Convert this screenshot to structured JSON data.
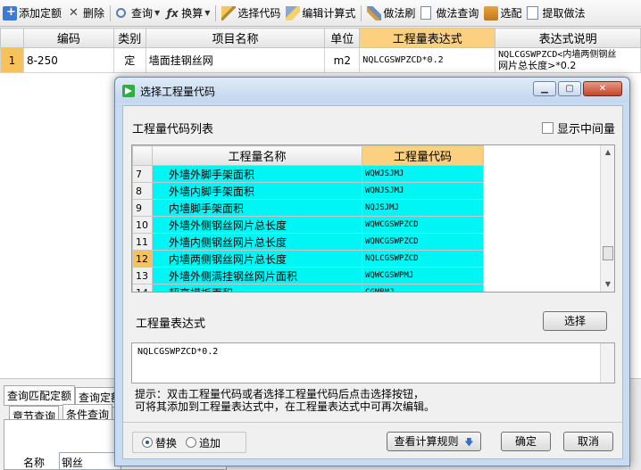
{
  "toolbar": {
    "add_quota": "添加定额",
    "delete": "删除",
    "query": "查询",
    "convert": "换算",
    "pick_code": "选择代码",
    "edit_formula": "编辑计算式",
    "method_brush": "做法刷",
    "method_query": "做法查询",
    "match": "选配",
    "extract_method": "提取做法"
  },
  "main_grid": {
    "columns": [
      "编码",
      "类别",
      "项目名称",
      "单位",
      "工程量表达式",
      "表达式说明"
    ],
    "rows": [
      {
        "num": "1",
        "code": "8-250",
        "type": "定",
        "name": "墙面挂钢丝网",
        "unit": "m2",
        "expr": "NQLCGSWPZCD*0.2",
        "desc_line1": "NQLCGSWPZCD<内墙两侧钢丝",
        "desc_line2": "网片总长度>*0.2"
      }
    ]
  },
  "lower_panel": {
    "tab_match": "查询匹配定额",
    "tab_query": "查询定额",
    "tab_chapter": "章节查询",
    "tab_condition": "条件查询",
    "name_label": "名称",
    "name_value": "钢丝"
  },
  "dialog": {
    "title": "选择工程量代码",
    "list_label": "工程量代码列表",
    "show_intermediate": "显示中间量",
    "col_name": "工程量名称",
    "col_code": "工程量代码",
    "items": [
      {
        "num": "7",
        "name": "外墙外脚手架面积",
        "code": "WQWJSJMJ"
      },
      {
        "num": "8",
        "name": "外墙内脚手架面积",
        "code": "WQNJSJMJ"
      },
      {
        "num": "9",
        "name": "内墙脚手架面积",
        "code": "NQJSJMJ"
      },
      {
        "num": "10",
        "name": "外墙外侧钢丝网片总长度",
        "code": "WQWCGSWPZCD"
      },
      {
        "num": "11",
        "name": "外墙内侧钢丝网片总长度",
        "code": "WQNCGSWPZCD"
      },
      {
        "num": "12",
        "name": "内墙两侧钢丝网片总长度",
        "code": "NQLCGSWPZCD"
      },
      {
        "num": "13",
        "name": "外墙外侧满挂钢丝网片面积",
        "code": "WQWCGSWPMJ"
      },
      {
        "num": "14",
        "name": "超高模板面积",
        "code": "CGMBMJ"
      }
    ],
    "selected_num": "12",
    "expr_label": "工程量表达式",
    "select_button": "选择",
    "expr_value": "NQLCGSWPZCD*0.2",
    "tip_line1": "提示：双击工程量代码或者选择工程量代码后点击选择按钮，",
    "tip_line2": "可将其添加到工程量表达式中，在工程量表达式中可再次编辑。",
    "radio_replace": "替换",
    "radio_append": "追加",
    "rules_button": "查看计算规则",
    "ok_button": "确定",
    "cancel_button": "取消"
  },
  "colors": {
    "highlight_header": "#fbd080",
    "cyan_cells": "#00f5f5",
    "selected_row": "#f7c25b"
  }
}
